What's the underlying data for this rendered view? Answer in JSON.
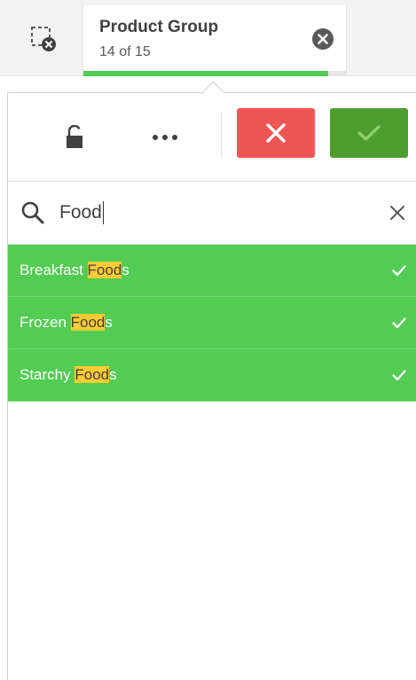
{
  "selection_tab": {
    "title": "Product Group",
    "count": "14 of 15",
    "progress": 0.9333
  },
  "search": {
    "value": "Food",
    "highlight": "Food"
  },
  "list_items": [
    {
      "label": "Breakfast Foods",
      "pre": "Breakfast ",
      "match": "Food",
      "post": "s",
      "selected": true
    },
    {
      "label": "Frozen Foods",
      "pre": "Frozen ",
      "match": "Food",
      "post": "s",
      "selected": true
    },
    {
      "label": "Starchy Foods",
      "pre": "Starchy ",
      "match": "Food",
      "post": "s",
      "selected": true
    }
  ],
  "colors": {
    "selected_green": "#52cc52",
    "highlight_yellow": "#ffcc33",
    "cancel_red": "#f05555",
    "confirm_green": "#4d9e2f"
  },
  "icons": {
    "clear_selections": "clear-selections-icon",
    "tab_close": "close-circle-icon",
    "lock": "unlock-icon",
    "more": "more-horizontal-icon",
    "cancel": "close-icon",
    "confirm": "checkmark-icon",
    "search": "search-icon",
    "search_clear": "close-icon",
    "row_check": "checkmark-icon"
  }
}
